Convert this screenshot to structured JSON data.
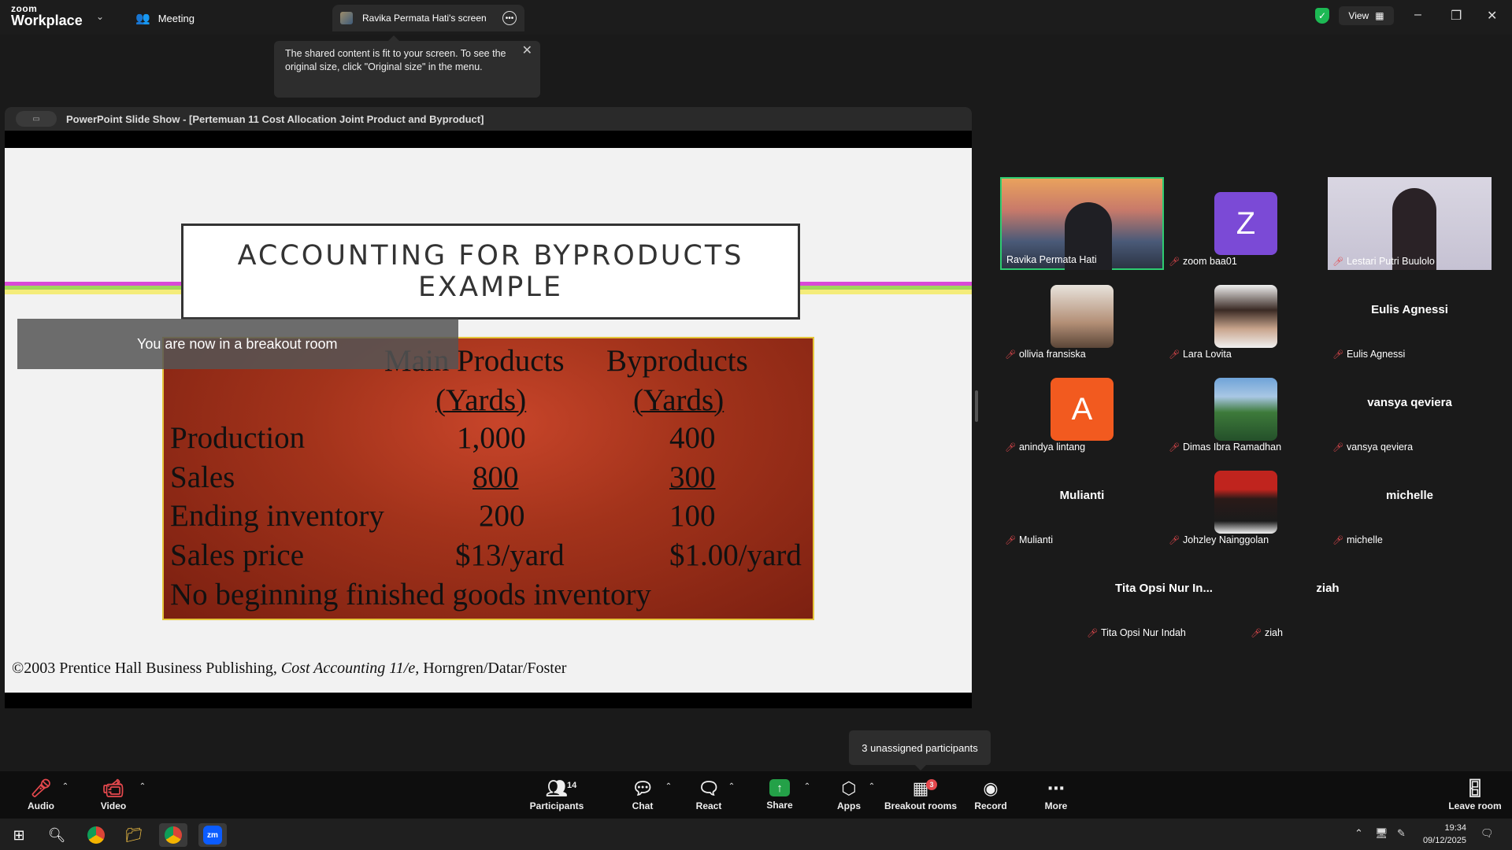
{
  "topbar": {
    "brand_small": "zoom",
    "brand_large": "Workplace",
    "meeting_label": "Meeting",
    "share_tab_label": "Ravika Permata Hati's screen",
    "view_label": "View"
  },
  "tooltip": {
    "text": "The shared content is fit to your screen. To see the original size, click \"Original size\" in the menu."
  },
  "ppt": {
    "window_title": "PowerPoint Slide Show - [Pertemuan 11 Cost Allocation Joint Product and Byproduct]",
    "slide_title_line1": "ACCOUNTING FOR BYPRODUCTS",
    "slide_title_line2": "EXAMPLE",
    "breakout_banner": "You are now in a breakout room",
    "table": {
      "col1_header": "Main Products",
      "col2_header": "Byproducts",
      "col1_unit": "(Yards)",
      "col2_unit": "(Yards)",
      "rows": [
        {
          "label": "Production",
          "main": "1,000",
          "by": "400"
        },
        {
          "label": "Sales",
          "main": "800",
          "by": "300"
        },
        {
          "label": "Ending inventory",
          "main": "200",
          "by": "100"
        },
        {
          "label": "Sales price",
          "main": "$13/yard",
          "by": "$1.00/yard"
        }
      ],
      "note": "No beginning finished goods inventory"
    },
    "footer_prefix": "©2003 Prentice Hall Business Publishing,",
    "footer_book": "Cost Accounting 11/e,",
    "footer_authors": "Horngren/Datar/Foster"
  },
  "participants_grid": [
    {
      "label": "Ravika Permata Hati",
      "type": "video",
      "active": true
    },
    {
      "label": "zoom baa01",
      "type": "letter",
      "letter": "Z",
      "color": "#7b4ad6"
    },
    {
      "label": "Lestari Putri Buulolo",
      "type": "video"
    },
    {
      "label": "ollivia fransiska",
      "type": "photo"
    },
    {
      "label": "Lara Lovita",
      "type": "photo"
    },
    {
      "label": "Eulis Agnessi",
      "type": "name",
      "display": "Eulis Agnessi"
    },
    {
      "label": "anindya lintang",
      "type": "letter",
      "letter": "A",
      "color": "#f25a1f"
    },
    {
      "label": "Dimas Ibra Ramadhan",
      "type": "photo"
    },
    {
      "label": "vansya qeviera",
      "type": "name",
      "display": "vansya qeviera"
    },
    {
      "label": "Mulianti",
      "type": "name",
      "display": "Mulianti"
    },
    {
      "label": "Johzley Nainggolan",
      "type": "photo"
    },
    {
      "label": "michelle",
      "type": "name",
      "display": "michelle"
    },
    {
      "label": "Tita Opsi Nur Indah",
      "type": "name",
      "display": "Tita Opsi Nur In..."
    },
    {
      "label": "ziah",
      "type": "name",
      "display": "ziah"
    }
  ],
  "unassigned_tooltip": "3 unassigned participants",
  "toolbar": {
    "audio": "Audio",
    "video": "Video",
    "participants": "Participants",
    "participants_count": "14",
    "chat": "Chat",
    "react": "React",
    "share": "Share",
    "apps": "Apps",
    "breakout": "Breakout rooms",
    "breakout_badge": "3",
    "record": "Record",
    "more": "More",
    "leave": "Leave room"
  },
  "taskbar": {
    "time": "19:34",
    "date": "09/12/2025"
  },
  "colors": {
    "active_border": "#2ecc71",
    "muted_mic": "#e5484d",
    "share_green": "#24a148"
  }
}
